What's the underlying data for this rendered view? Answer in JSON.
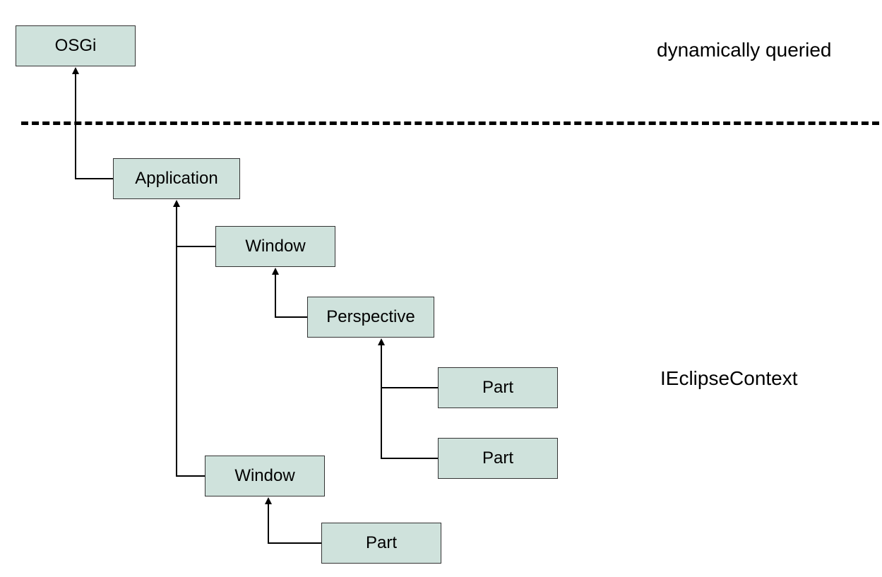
{
  "nodes": {
    "osgi": "OSGi",
    "application": "Application",
    "window1": "Window",
    "perspective": "Perspective",
    "part1": "Part",
    "part2": "Part",
    "window2": "Window",
    "part3": "Part"
  },
  "labels": {
    "top": "dynamically queried",
    "bottom": "IEclipseContext"
  }
}
